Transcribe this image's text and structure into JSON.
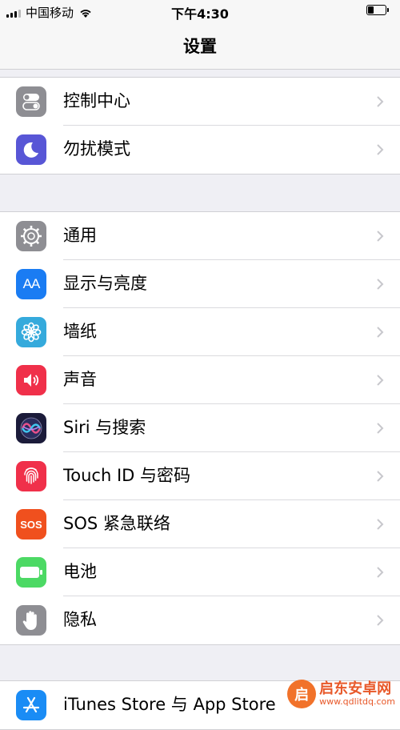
{
  "status_bar": {
    "carrier": "中国移动",
    "time": "下午4:30"
  },
  "nav": {
    "title": "设置"
  },
  "groups": [
    {
      "items": [
        {
          "label": "控制中心",
          "icon": "control-center-icon",
          "color": "#8e8e93"
        },
        {
          "label": "勿扰模式",
          "icon": "moon-icon",
          "color": "#5856d6"
        }
      ]
    },
    {
      "items": [
        {
          "label": "通用",
          "icon": "gear-icon",
          "color": "#8e8e93"
        },
        {
          "label": "显示与亮度",
          "icon": "display-aa-icon",
          "color": "#1a7cf3"
        },
        {
          "label": "墙纸",
          "icon": "wallpaper-flower-icon",
          "color": "#35aadc"
        },
        {
          "label": "声音",
          "icon": "speaker-icon",
          "color": "#f0304a"
        },
        {
          "label": "Siri 与搜索",
          "icon": "siri-icon",
          "color": "#1b1b3a"
        },
        {
          "label": "Touch ID 与密码",
          "icon": "fingerprint-icon",
          "color": "#f0304a"
        },
        {
          "label": "SOS 紧急联络",
          "icon": "sos-icon",
          "color": "#f0501e"
        },
        {
          "label": "电池",
          "icon": "battery-icon",
          "color": "#4cd964"
        },
        {
          "label": "隐私",
          "icon": "hand-icon",
          "color": "#8e8e93"
        }
      ]
    },
    {
      "items": [
        {
          "label": "iTunes Store 与 App Store",
          "icon": "app-store-icon",
          "color": "#1a8cf5"
        }
      ]
    }
  ],
  "icon_text": {
    "aa": "AA",
    "sos": "SOS"
  },
  "watermark": {
    "logo_char": "启",
    "name": "启东安卓网",
    "url": "www.qdlitdq.com"
  }
}
